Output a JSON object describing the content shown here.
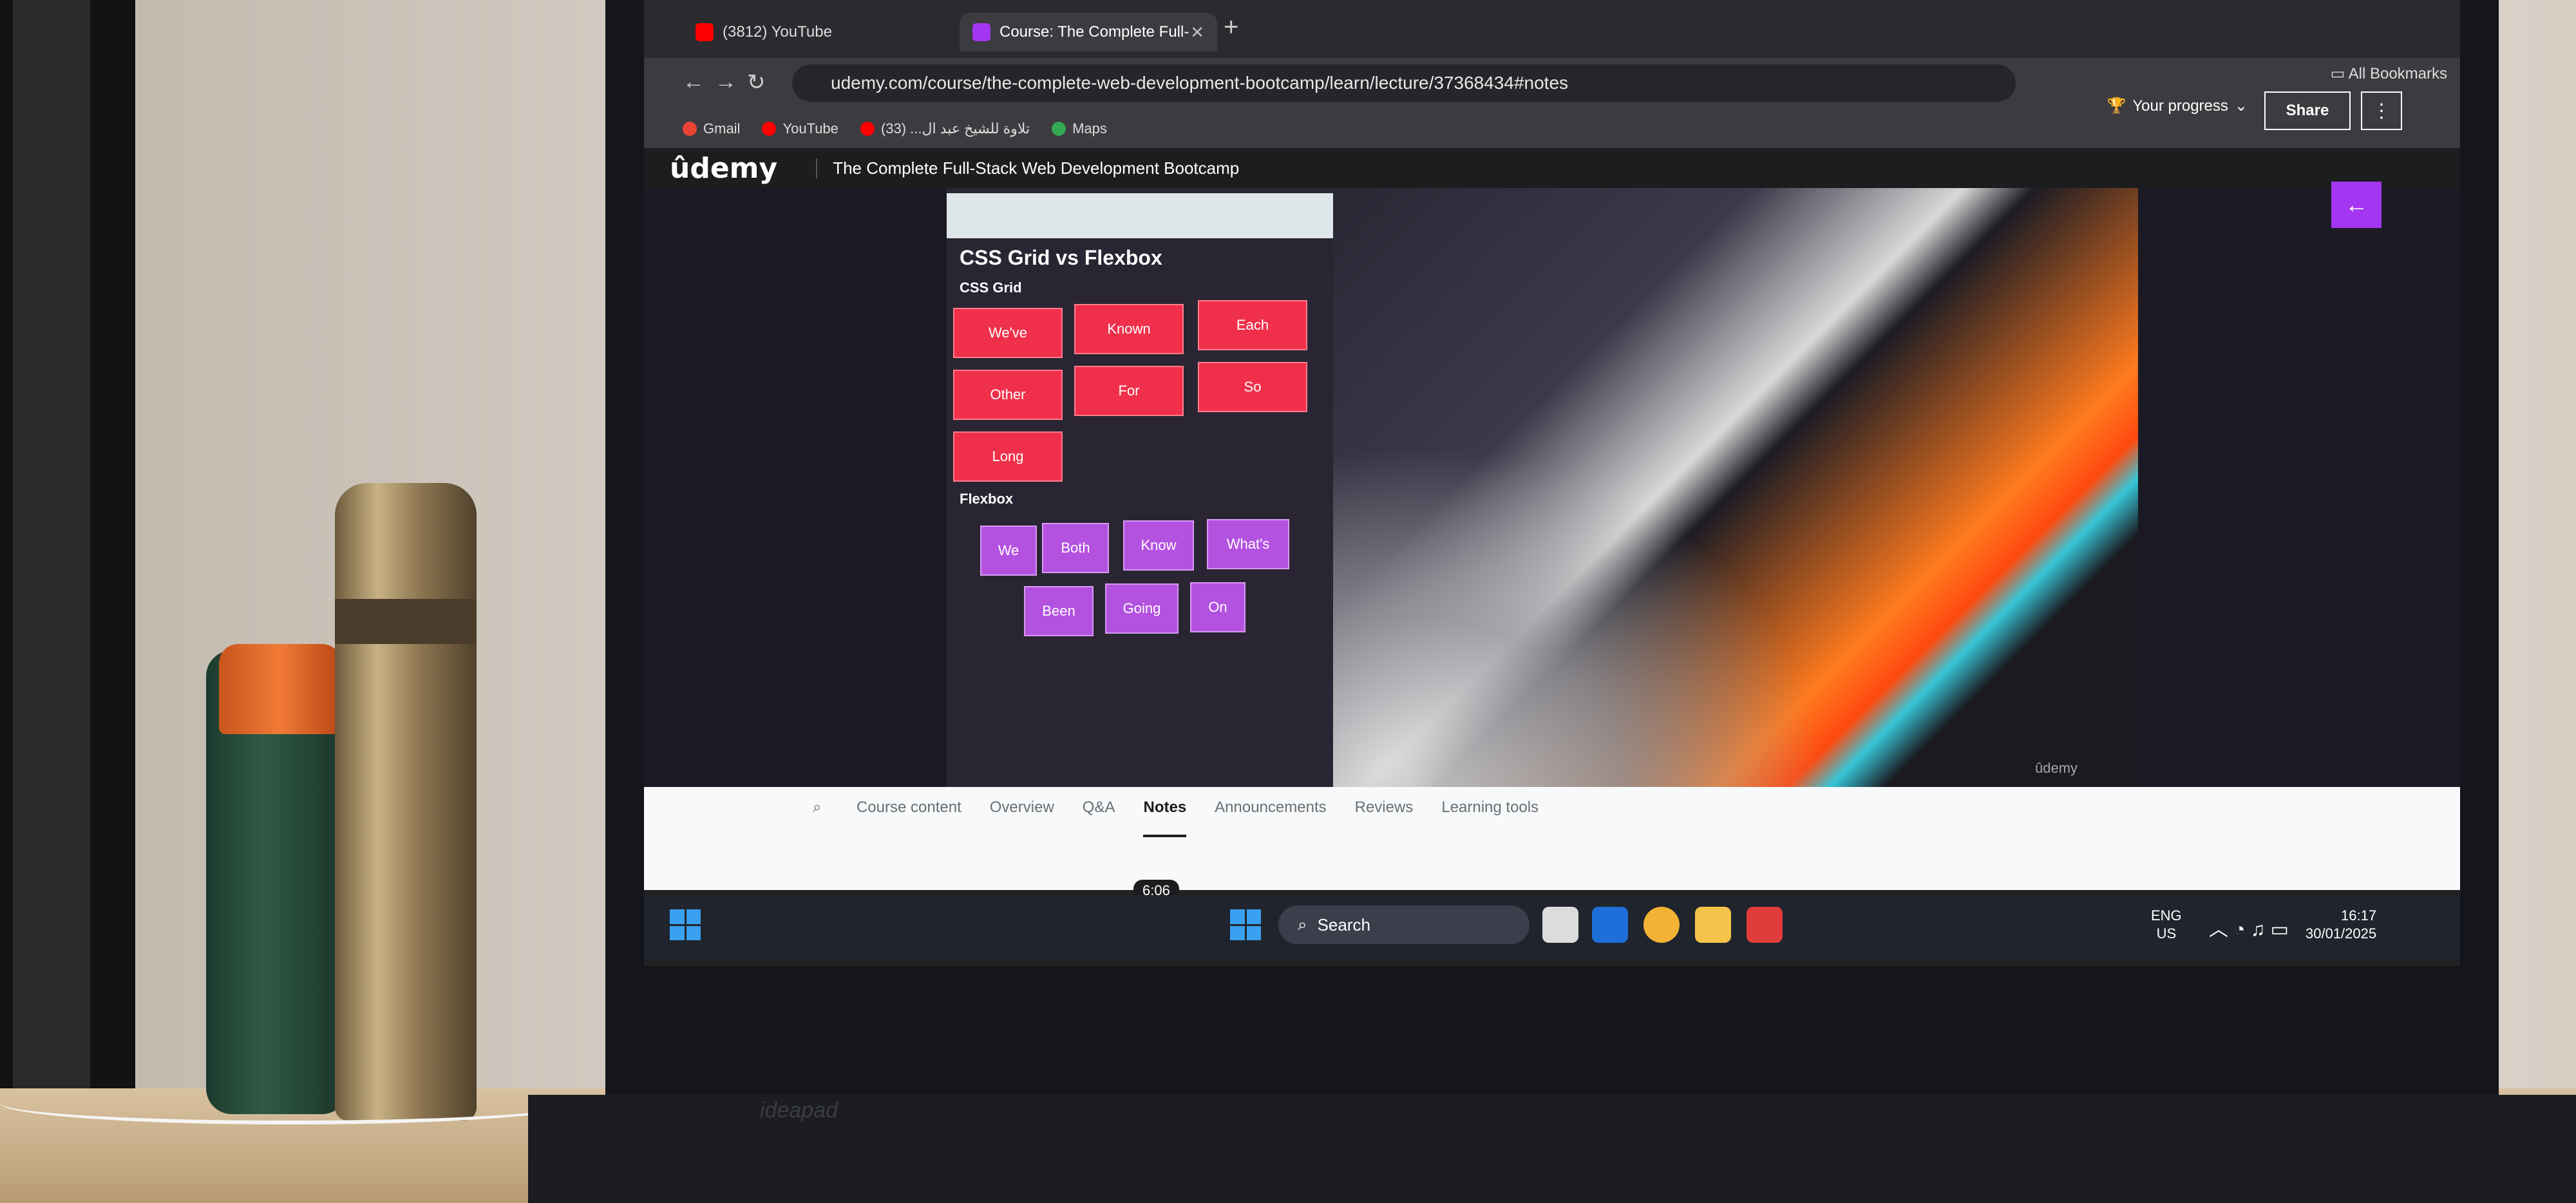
{
  "browser": {
    "tabs": [
      {
        "label": "(3812) YouTube",
        "favicon_color": "#ff0000"
      },
      {
        "label": "Course: The Complete Full-",
        "favicon_color": "#a435f0"
      }
    ],
    "url": "udemy.com/course/the-complete-web-development-bootcamp/learn/lecture/37368434#notes",
    "bookmarks": [
      {
        "label": "Gmail",
        "color": "#ea4335"
      },
      {
        "label": "YouTube",
        "color": "#ff0000"
      },
      {
        "label": "تلاوة للشيخ عبد ال... (33)",
        "color": "#ff0000"
      },
      {
        "label": "Maps",
        "color": "#34a853"
      }
    ],
    "all_bookmarks": "All Bookmarks"
  },
  "udemy": {
    "logo": "ûdemy",
    "course_title": "The Complete Full-Stack Web Development Bootcamp",
    "progress_label": "Your progress",
    "share_label": "Share",
    "accent": "#a435f0"
  },
  "video": {
    "inner_heading": "CSS Grid vs Flexbox",
    "grid_label": "CSS Grid",
    "grid_items": [
      "We've",
      "Known",
      "Each",
      "Other",
      "For",
      "So",
      "Long"
    ],
    "flex_label": "Flexbox",
    "flex_items": [
      "We",
      "Both",
      "Know",
      "What's",
      "Been",
      "Going",
      "On"
    ],
    "watermark": "ûdemy",
    "timestamp": "6:06"
  },
  "course_nav": {
    "tabs": [
      "Course content",
      "Overview",
      "Q&A",
      "Notes",
      "Announcements",
      "Reviews",
      "Learning tools"
    ],
    "active_tab": "Notes"
  },
  "taskbar": {
    "search_label": "Search",
    "lang_1": "ENG",
    "lang_2": "US",
    "time": "16:17",
    "date": "30/01/2025"
  },
  "laptop_brand": "ideapad"
}
